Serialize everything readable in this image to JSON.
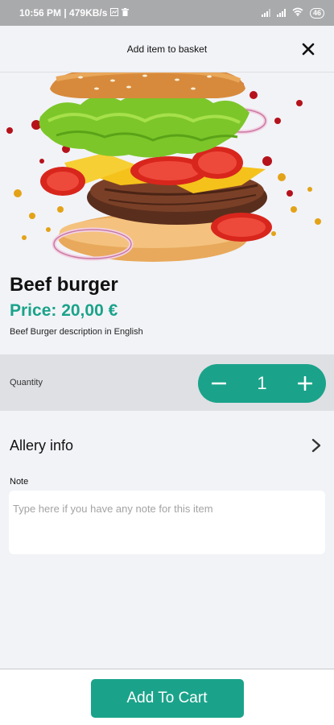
{
  "status_bar": {
    "time_speed": "10:56 PM | 479KB/s",
    "battery": "46",
    "icons": [
      "image-icon",
      "trash-icon",
      "signal-icon",
      "signal-icon",
      "wifi-icon",
      "battery-icon"
    ]
  },
  "header": {
    "title": "Add item to basket",
    "close_icon": "close-icon"
  },
  "product": {
    "image": "burger-photo",
    "name": "Beef burger",
    "price": "Price: 20,00 €",
    "description": "Beef Burger description in English"
  },
  "quantity": {
    "label": "Quantity",
    "value": "1",
    "decrement_icon": "minus-icon",
    "increment_icon": "plus-icon"
  },
  "allergy": {
    "label": "Allery info",
    "icon": "chevron-right-icon"
  },
  "note": {
    "label": "Note",
    "placeholder": "Type here if you have any note for this item",
    "value": ""
  },
  "footer": {
    "add_to_cart_label": "Add To Cart"
  },
  "colors": {
    "accent": "#1aa38a",
    "background": "#f2f3f7",
    "quantity_row": "#dfe0e4",
    "status_bar": "#a9aaac"
  }
}
